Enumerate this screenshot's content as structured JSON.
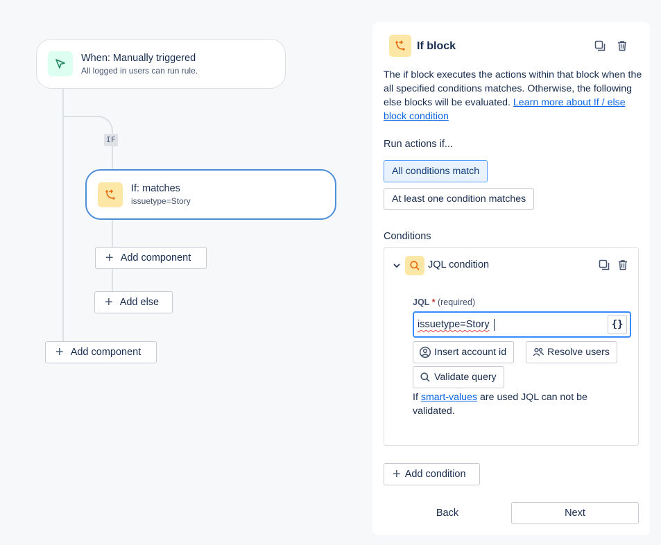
{
  "trigger": {
    "title": "When: Manually triggered",
    "subtitle": "All logged in users can run rule.",
    "icon": "cursor-icon",
    "icon_bg": "#dcfff1",
    "icon_color": "#1f845a"
  },
  "branch_badge": "IF",
  "if_node": {
    "title": "If: matches",
    "subtitle": "issuetype=Story",
    "icon": "branch-icon"
  },
  "canvas_buttons": {
    "inner_add_component": "Add component",
    "add_else": "Add else",
    "outer_add_component": "Add component"
  },
  "panel": {
    "title": "If block",
    "description": "The if block executes the actions within that block when the all specified conditions matches. Otherwise, the following else blocks will be evaluated.",
    "learn_more": "Learn more about If / else block condition",
    "run_actions_label": "Run actions if...",
    "options": [
      {
        "label": "All conditions match",
        "selected": true
      },
      {
        "label": "At least one condition matches",
        "selected": false
      }
    ],
    "conditions_label": "Conditions",
    "condition": {
      "title": "JQL condition",
      "field_label": "JQL",
      "required_mark": "*",
      "required_text": "(required)",
      "value": "issuetype=Story",
      "smart_value_button": "{}",
      "insert_account_id": "Insert account id",
      "resolve_users": "Resolve users",
      "validate_query": "Validate query",
      "note_prefix": "If",
      "note_link": "smart-values",
      "note_suffix": "are used JQL can not be validated."
    },
    "add_condition": "Add condition",
    "back": "Back",
    "next": "Next"
  },
  "colors": {
    "accent": "#0c66e4",
    "selected_border": "#579dff",
    "if_node_border": "#4c8ed9",
    "icon_yellow": "#fde7a6",
    "icon_orange": "#e56910"
  }
}
